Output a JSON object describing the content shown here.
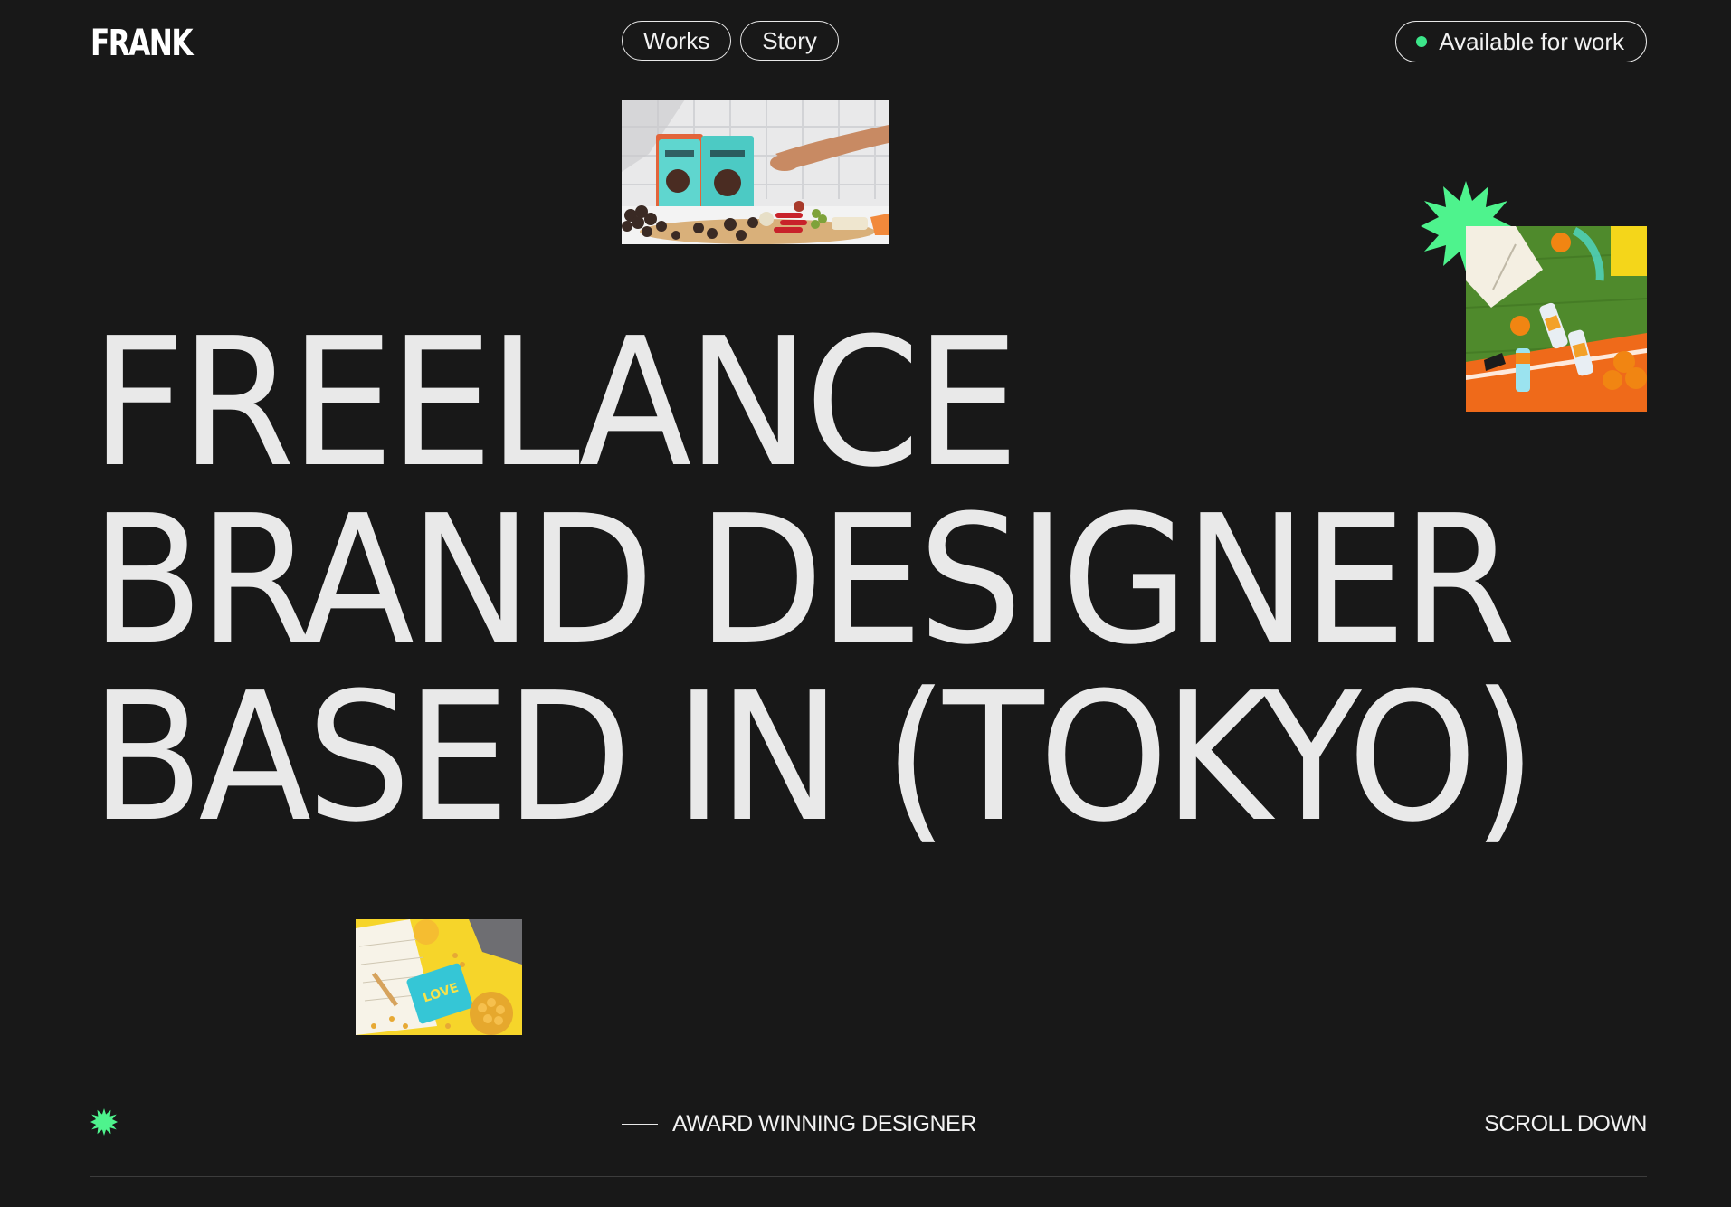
{
  "header": {
    "logo": "FRANK",
    "nav": [
      {
        "label": "Works"
      },
      {
        "label": "Story"
      }
    ],
    "status": {
      "label": "Available for work",
      "dot_color": "#3ce68a"
    }
  },
  "hero": {
    "lines": [
      "FREELANCE",
      "BRAND DESIGNER",
      "BASED IN (TOKYO)"
    ]
  },
  "footer": {
    "award_label": "AWARD WINNING DESIGNER",
    "scroll_label": "SCROLL DOWN"
  },
  "colors": {
    "background": "#181818",
    "text": "#e9e9e9",
    "accent": "#3ce68a"
  }
}
